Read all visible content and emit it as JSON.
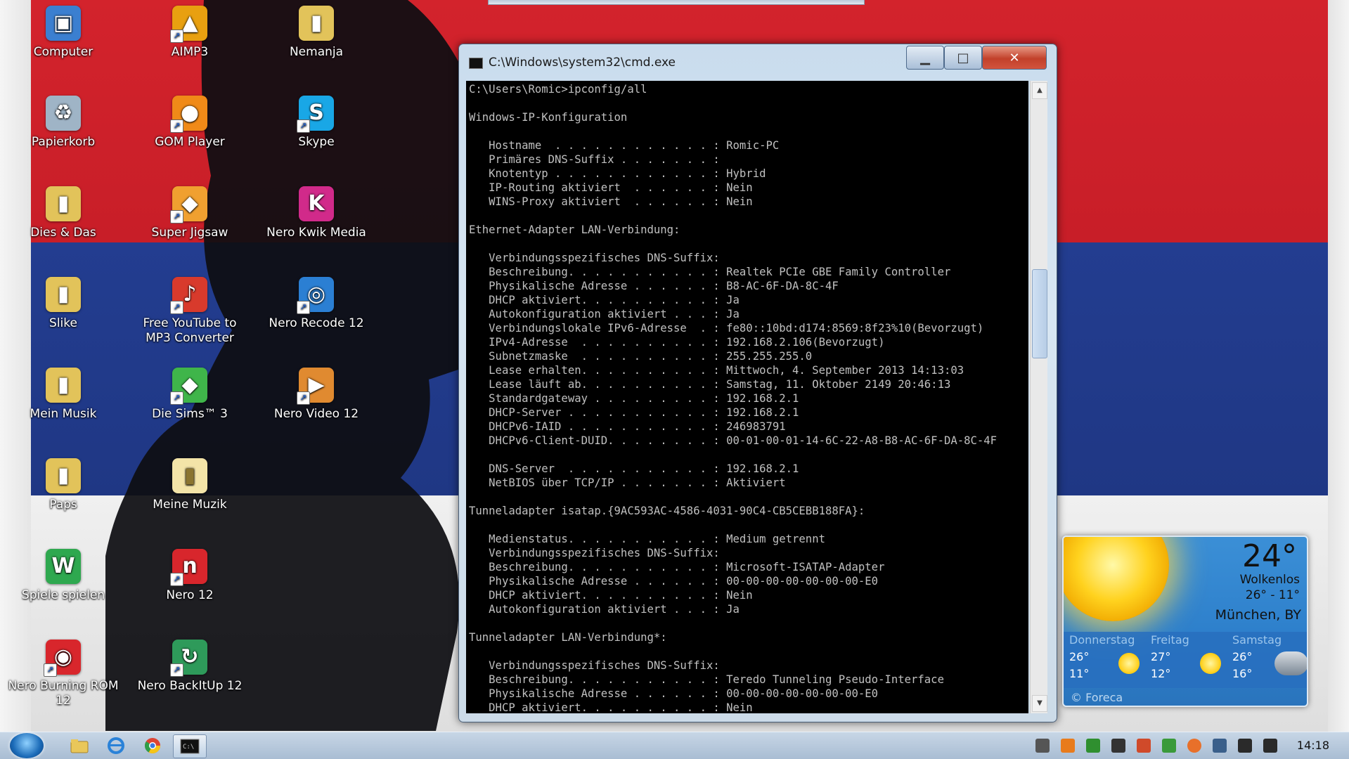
{
  "desktop_icons": [
    {
      "label": "Computer",
      "icon": "computer-icon",
      "color": "#3b7fd0",
      "glyph": "▣"
    },
    {
      "label": "AIMP3",
      "icon": "aimp3-icon",
      "color": "#e8a010",
      "glyph": "▲"
    },
    {
      "label": "Nemanja",
      "icon": "folder-icon",
      "color": "#e2c35a",
      "glyph": "▮"
    },
    {
      "label": "Papierkorb",
      "icon": "recycle-bin-icon",
      "color": "#9fb4c6",
      "glyph": "♻"
    },
    {
      "label": "GOM Player",
      "icon": "gom-player-icon",
      "color": "#f08a18",
      "glyph": "●"
    },
    {
      "label": "Skype",
      "icon": "skype-icon",
      "color": "#19a7e6",
      "glyph": "S"
    },
    {
      "label": "Dies & Das",
      "icon": "folder-icon",
      "color": "#e2c35a",
      "glyph": "▮"
    },
    {
      "label": "Super Jigsaw",
      "icon": "super-jigsaw-icon",
      "color": "#f0a030",
      "glyph": "◆"
    },
    {
      "label": "Nero Kwik Media",
      "icon": "nero-kwik-media-icon",
      "color": "#d12a8a",
      "glyph": "K"
    },
    {
      "label": "Slike",
      "icon": "folder-icon",
      "color": "#e2c35a",
      "glyph": "▮"
    },
    {
      "label": "Free YouTube to MP3 Converter",
      "icon": "youtube-mp3-icon",
      "color": "#d83a2c",
      "glyph": "♪"
    },
    {
      "label": "Nero Recode 12",
      "icon": "nero-recode-icon",
      "color": "#2b7fd3",
      "glyph": "◎"
    },
    {
      "label": "Mein Musik",
      "icon": "folder-icon",
      "color": "#e2c35a",
      "glyph": "▮"
    },
    {
      "label": "Die Sims™ 3",
      "icon": "sims3-icon",
      "color": "#3fb54a",
      "glyph": "◆"
    },
    {
      "label": "Nero Video 12",
      "icon": "nero-video-icon",
      "color": "#e08a30",
      "glyph": "▶"
    },
    {
      "label": "Paps",
      "icon": "folder-icon",
      "color": "#e2c35a",
      "glyph": "▮"
    },
    {
      "label": "Meine Muzik",
      "icon": "folder-icon",
      "color": "#f3e4a8",
      "glyph": "▮"
    },
    {
      "label": "Spiele spielen",
      "icon": "games-icon",
      "color": "#2ea84f",
      "glyph": "W"
    },
    {
      "label": "Nero 12",
      "icon": "nero-12-icon",
      "color": "#d8262c",
      "glyph": "n"
    },
    {
      "label": "Nero Burning ROM 12",
      "icon": "nero-burning-rom-icon",
      "color": "#d8262c",
      "glyph": "◉"
    },
    {
      "label": "Nero BackItUp 12",
      "icon": "nero-backitup-icon",
      "color": "#2e9a5a",
      "glyph": "↻"
    }
  ],
  "cmd": {
    "title": "C:\\Windows\\system32\\cmd.exe",
    "minimize_label": "▁",
    "maximize_label": "□",
    "close_label": "✕",
    "output": "C:\\Users\\Romic>ipconfig/all\n\nWindows-IP-Konfiguration\n\n   Hostname  . . . . . . . . . . . . : Romic-PC\n   Primäres DNS-Suffix . . . . . . . :\n   Knotentyp . . . . . . . . . . . . : Hybrid\n   IP-Routing aktiviert  . . . . . . : Nein\n   WINS-Proxy aktiviert  . . . . . . : Nein\n\nEthernet-Adapter LAN-Verbindung:\n\n   Verbindungsspezifisches DNS-Suffix:\n   Beschreibung. . . . . . . . . . . : Realtek PCIe GBE Family Controller\n   Physikalische Adresse . . . . . . : B8-AC-6F-DA-8C-4F\n   DHCP aktiviert. . . . . . . . . . : Ja\n   Autokonfiguration aktiviert . . . : Ja\n   Verbindungslokale IPv6-Adresse  . : fe80::10bd:d174:8569:8f23%10(Bevorzugt)\n   IPv4-Adresse  . . . . . . . . . . : 192.168.2.106(Bevorzugt)\n   Subnetzmaske  . . . . . . . . . . : 255.255.255.0\n   Lease erhalten. . . . . . . . . . : Mittwoch, 4. September 2013 14:13:03\n   Lease läuft ab. . . . . . . . . . : Samstag, 11. Oktober 2149 20:46:13\n   Standardgateway . . . . . . . . . : 192.168.2.1\n   DHCP-Server . . . . . . . . . . . : 192.168.2.1\n   DHCPv6-IAID . . . . . . . . . . . : 246983791\n   DHCPv6-Client-DUID. . . . . . . . : 00-01-00-01-14-6C-22-A8-B8-AC-6F-DA-8C-4F\n\n   DNS-Server  . . . . . . . . . . . : 192.168.2.1\n   NetBIOS über TCP/IP . . . . . . . : Aktiviert\n\nTunneladapter isatap.{9AC593AC-4586-4031-90C4-CB5CEBB188FA}:\n\n   Medienstatus. . . . . . . . . . . : Medium getrennt\n   Verbindungsspezifisches DNS-Suffix:\n   Beschreibung. . . . . . . . . . . : Microsoft-ISATAP-Adapter\n   Physikalische Adresse . . . . . . : 00-00-00-00-00-00-00-E0\n   DHCP aktiviert. . . . . . . . . . : Nein\n   Autokonfiguration aktiviert . . . : Ja\n\nTunneladapter LAN-Verbindung*:\n\n   Verbindungsspezifisches DNS-Suffix:\n   Beschreibung. . . . . . . . . . . : Teredo Tunneling Pseudo-Interface\n   Physikalische Adresse . . . . . . : 00-00-00-00-00-00-00-E0\n   DHCP aktiviert. . . . . . . . . . : Nein",
    "scroll_up": "▲",
    "scroll_down": "▼"
  },
  "weather": {
    "temperature": "24°",
    "condition": "Wolkenlos",
    "range": "26° - 11°",
    "city": "München, BY",
    "credit": "© Foreca",
    "forecast": [
      {
        "day": "Donnerstag",
        "high": "26°",
        "low": "11°",
        "icon": "sunny-icon"
      },
      {
        "day": "Freitag",
        "high": "27°",
        "low": "12°",
        "icon": "sunny-icon"
      },
      {
        "day": "Samstag",
        "high": "26°",
        "low": "16°",
        "icon": "thunderstorm-icon"
      }
    ]
  },
  "taskbar": {
    "clock": "14:18",
    "pinned": [
      "explorer-icon",
      "internet-explorer-icon",
      "chrome-icon",
      "cmd-icon"
    ],
    "tray": [
      {
        "icon": "webcam-icon",
        "color": "#555555"
      },
      {
        "icon": "aimp-tray-icon",
        "color": "#e87b1c"
      },
      {
        "icon": "tray-app-icon",
        "color": "#2f8f2f"
      },
      {
        "icon": "monitor-tray-icon",
        "color": "#333333"
      },
      {
        "icon": "volume-app-icon",
        "color": "#d04a2a"
      },
      {
        "icon": "security-icon",
        "color": "#3a9a3a"
      },
      {
        "icon": "update-icon",
        "color": "#e8702a"
      },
      {
        "icon": "network-icon",
        "color": "#3a5f8a"
      },
      {
        "icon": "action-center-flag-icon",
        "color": "#2a2a2a"
      },
      {
        "icon": "speaker-icon",
        "color": "#2a2a2a"
      }
    ]
  }
}
